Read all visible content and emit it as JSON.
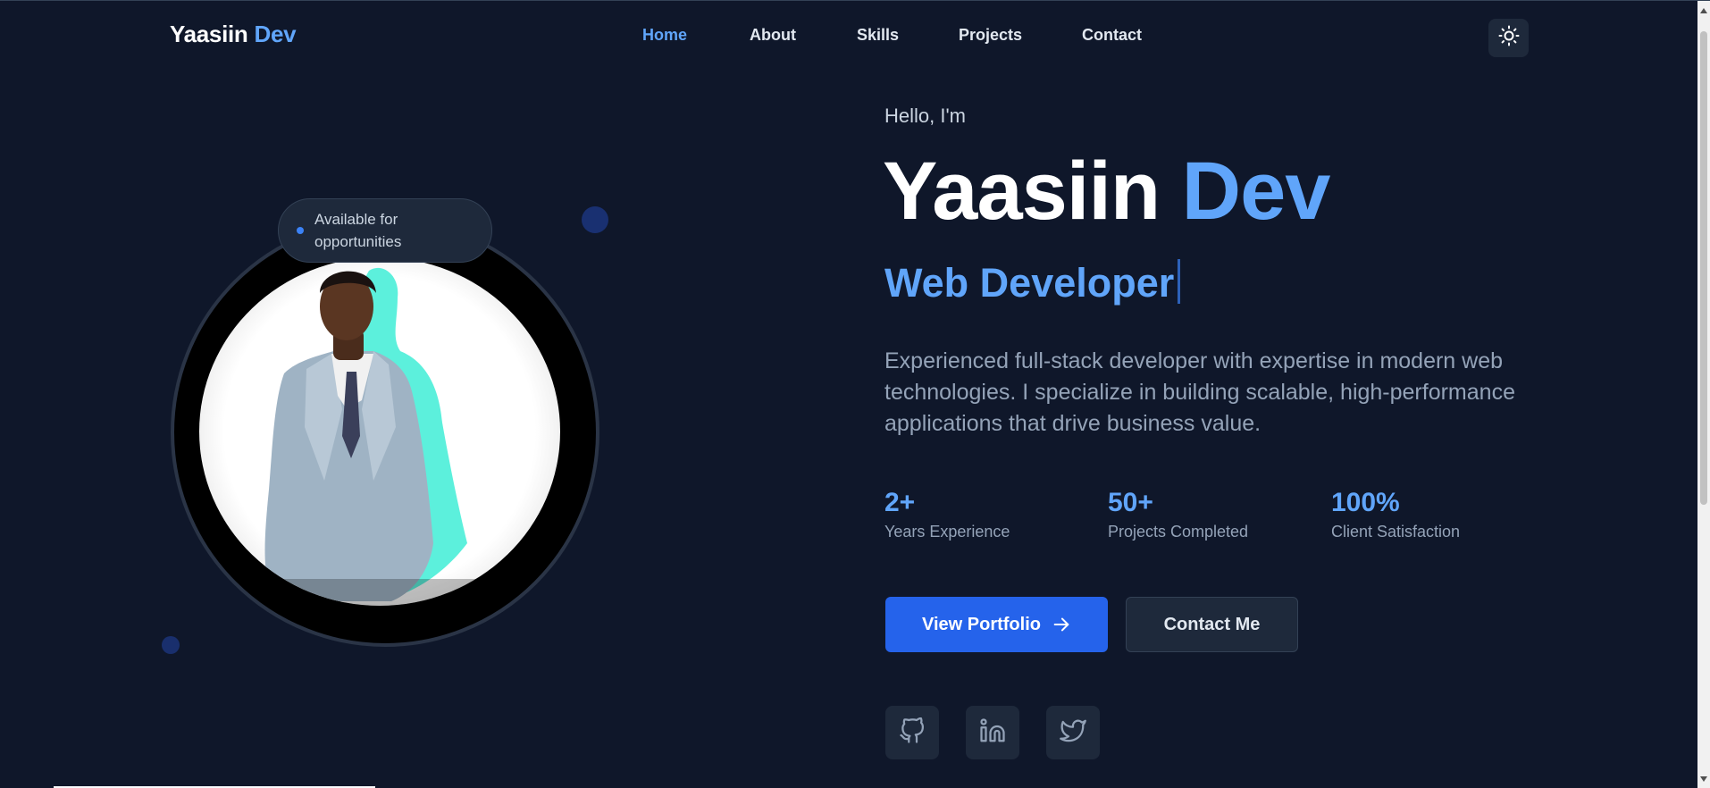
{
  "nav": {
    "brand": "Yaasiin",
    "brand_accent": "Dev",
    "links": [
      {
        "label": "Home",
        "active": true
      },
      {
        "label": "About",
        "active": false
      },
      {
        "label": "Skills",
        "active": false
      },
      {
        "label": "Projects",
        "active": false
      },
      {
        "label": "Contact",
        "active": false
      }
    ],
    "theme_toggle_icon": "sun-icon"
  },
  "profile": {
    "badge_text": "Available for opportunities",
    "photo_alt": "profile-photo"
  },
  "hero": {
    "greeting": "Hello, I'm",
    "name": "Yaasiin",
    "name_accent": "Dev",
    "role": "Web Developer",
    "description": "Experienced full-stack developer with expertise in modern web technologies. I specialize in building scalable, high-performance applications that drive business value."
  },
  "stats": [
    {
      "value": "2+",
      "label": "Years Experience"
    },
    {
      "value": "50+",
      "label": "Projects Completed"
    },
    {
      "value": "100%",
      "label": "Client Satisfaction"
    }
  ],
  "actions": {
    "primary_label": "View Portfolio",
    "primary_icon": "arrow-right-icon",
    "secondary_label": "Contact Me"
  },
  "social": [
    "github-icon",
    "linkedin-icon",
    "twitter-icon"
  ],
  "colors": {
    "background": "#0f172a",
    "accent": "#60a5fa",
    "primary_button": "#2563eb",
    "surface": "#1e293b"
  }
}
